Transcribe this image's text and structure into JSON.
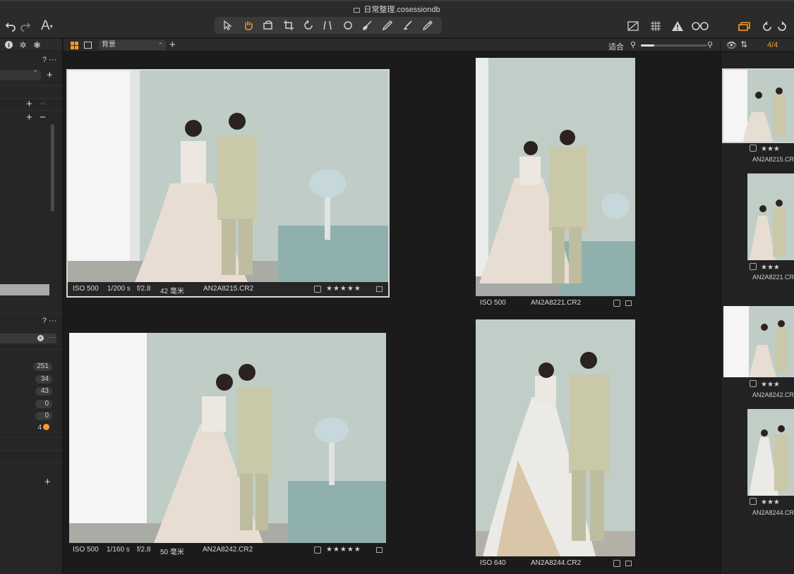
{
  "window": {
    "title": "日常整理.cosessiondb"
  },
  "toolbar": {
    "left_icons": [
      "undo-icon",
      "redo-icon",
      "text-icon"
    ],
    "tools": [
      "select-icon",
      "pan-icon",
      "layers-icon",
      "crop-icon",
      "rotate-icon",
      "keystone-icon",
      "circle-icon",
      "brush-icon",
      "eraser-icon",
      "gradient-icon",
      "pen-icon"
    ],
    "right_icons": [
      "exposure-warning-icon",
      "grid-icon",
      "alert-icon",
      "glasses-icon",
      "stack-icon",
      "reset-icon",
      "refresh-icon"
    ]
  },
  "left_panel": {
    "help_label": "? ···",
    "plus": "+",
    "minus": "−",
    "counts": [
      "251",
      "34",
      "43",
      "0",
      "0",
      "4"
    ]
  },
  "viewer_header": {
    "background_select": "背景",
    "plus": "+",
    "fit_label": "适合",
    "zoom_level": 0.2
  },
  "viewer": {
    "images": [
      {
        "iso": "ISO 500",
        "shutter": "1/200 s",
        "aperture": "f/2.8",
        "focal": "42 毫米",
        "filename": "AN2A8215.CR2",
        "stars": "★★★★★",
        "selected": true
      },
      {
        "iso": "ISO 500",
        "shutter": "",
        "aperture": "",
        "focal": "",
        "filename": "AN2A8221.CR2",
        "stars": "",
        "selected": false
      },
      {
        "iso": "ISO 500",
        "shutter": "1/160 s",
        "aperture": "f/2.8",
        "focal": "50 毫米",
        "filename": "AN2A8242.CR2",
        "stars": "★★★★★",
        "selected": false
      },
      {
        "iso": "ISO 640",
        "shutter": "",
        "aperture": "",
        "focal": "",
        "filename": "AN2A8244.CR2",
        "stars": "",
        "selected": false
      }
    ]
  },
  "right_panel": {
    "count": "4/4",
    "items": [
      {
        "stars": "★★★",
        "filename": "AN2A8215.CR"
      },
      {
        "stars": "★★★",
        "filename": "AN2A8221.CR"
      },
      {
        "stars": "★★★",
        "filename": "AN2A8242.CR"
      },
      {
        "stars": "★★★",
        "filename": "AN2A8244.CR"
      }
    ]
  },
  "colors": {
    "accent": "#f39a2b",
    "panel": "#2b2b2b",
    "viewer_bg": "#1b1b1b"
  }
}
